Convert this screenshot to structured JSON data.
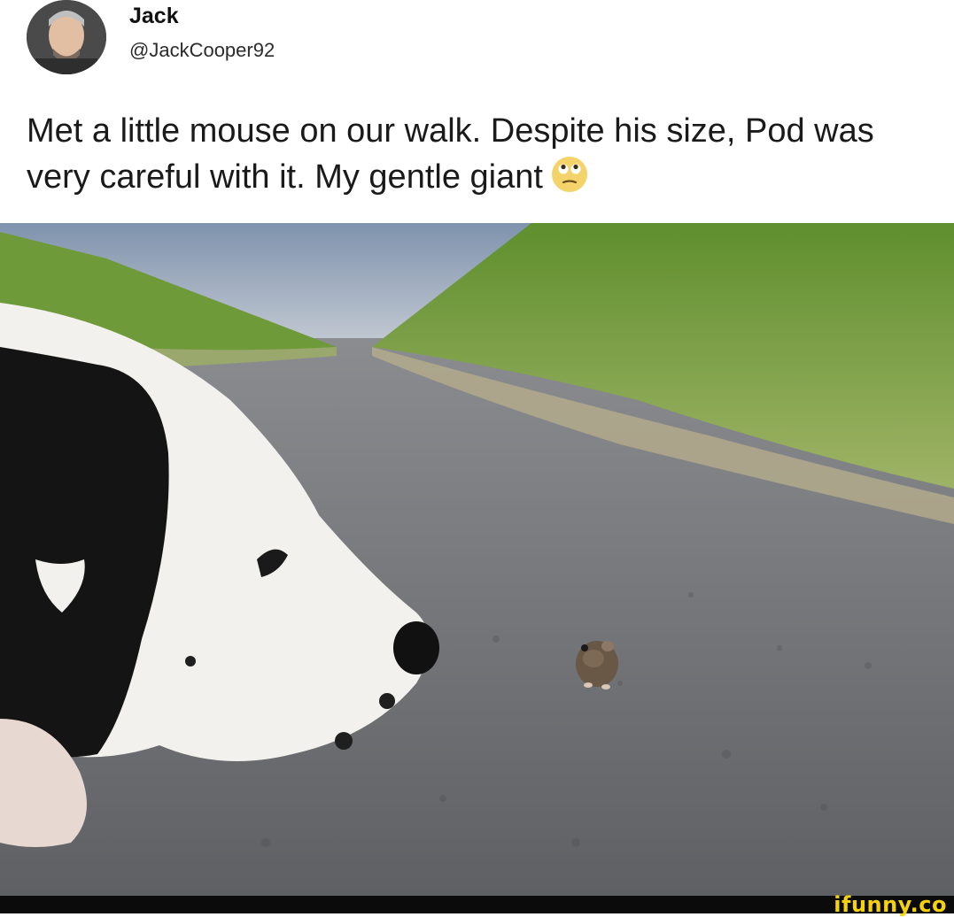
{
  "tweet": {
    "author": {
      "display_name": "Jack",
      "handle": "@JackCooper92",
      "avatar_icon": "avatar-photo-icon"
    },
    "text": "Met a little mouse on our walk. Despite his size, Pod was very careful with it. My gentle giant",
    "emoji_icon": "rolling-eyes-emoji-icon"
  },
  "watermark": {
    "text": "ifunny.co",
    "color": "#f5d20a"
  },
  "colors": {
    "background": "#ffffff",
    "text": "#1a1a1a"
  }
}
